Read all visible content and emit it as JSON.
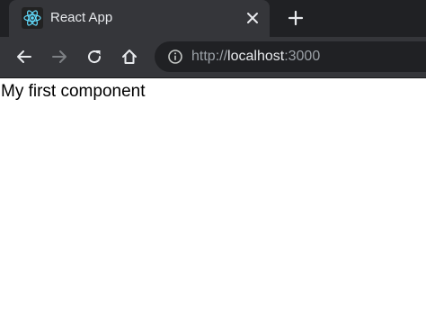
{
  "tab": {
    "title": "React App",
    "favicon": "react-logo-icon",
    "close_icon": "close-icon"
  },
  "new_tab_icon": "plus-icon",
  "toolbar": {
    "back_icon": "arrow-left-icon",
    "forward_icon": "arrow-right-icon",
    "reload_icon": "reload-icon",
    "home_icon": "home-icon",
    "info_icon": "info-icon"
  },
  "address_bar": {
    "scheme": "http://",
    "host": "localhost",
    "port": ":3000"
  },
  "page": {
    "text": "My first component"
  },
  "colors": {
    "tabstrip_bg": "#202124",
    "tab_bg": "#35363a",
    "omnibox_bg": "#202124",
    "react_logo": "#61dafb",
    "text_light": "#e8eaed",
    "text_dim": "#9aa0a6"
  }
}
